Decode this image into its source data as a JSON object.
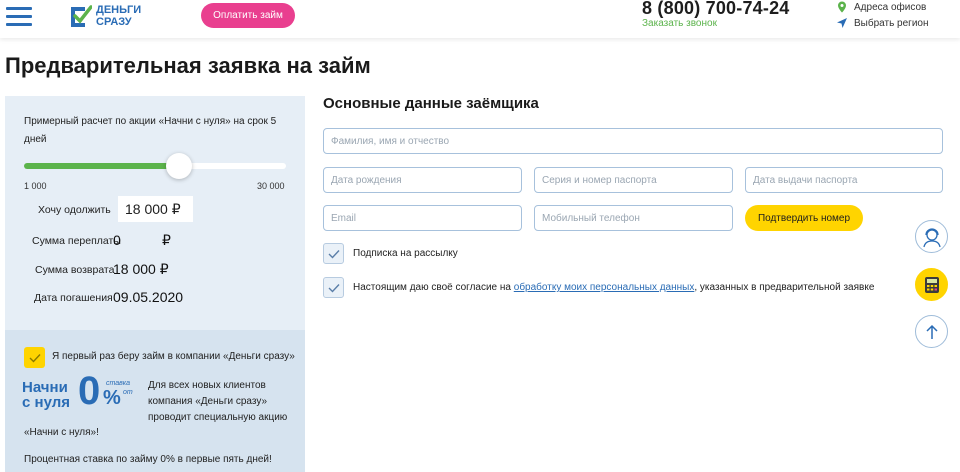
{
  "header": {
    "logo_line1": "ДЕНЬГИ",
    "logo_line2": "СРАЗУ",
    "pay_button": "Оплатить займ",
    "phone": "8 (800) 700-74-24",
    "callback": "Заказать звонок",
    "offices": "Адреса офисов",
    "region": "Выбрать регион"
  },
  "page_title": "Предварительная заявка на займ",
  "calculator": {
    "description": "Примерный расчет по акции «Начни с нуля» на срок 5 дней",
    "slider_min": "1 000",
    "slider_max": "30 000",
    "slider_value_fraction": 0.59,
    "want_label": "Хочу одолжить",
    "want_value": "18 000 ₽",
    "overpay_label": "Сумма переплаты",
    "overpay_value": "0",
    "overpay_currency": "₽",
    "return_label": "Сумма возврата",
    "return_value": "18 000 ₽",
    "due_label": "Дата погашения",
    "due_value": "09.05.2020"
  },
  "promo": {
    "checkbox_label": "Я первый раз беру займ в компании «Деньги сразу»",
    "logo_line1": "Начни",
    "logo_line2": "с нуля",
    "logo_zero": "0",
    "logo_percent": "%",
    "logo_small1": "ставка",
    "logo_small2": "от",
    "description": "Для всех новых клиентов компания «Деньги сразу» проводит специальную акцию",
    "description2": "«Начни с нуля»!",
    "description3": "Процентная ставка по займу 0% в первые пять дней!"
  },
  "form": {
    "section_title": "Основные данные заёмщика",
    "fullname_placeholder": "Фамилия, имя и отчество",
    "birthdate_placeholder": "Дата рождения",
    "passport_placeholder": "Серия и номер паспорта",
    "passport_date_placeholder": "Дата выдачи паспорта",
    "email_placeholder": "Email",
    "phone_placeholder": "Мобильный телефон",
    "confirm_button": "Подтвердить номер",
    "subscribe_label": "Подписка на рассылку",
    "consent_prefix": "Настоящим даю своё согласие на",
    "consent_link": "обработку моих персональных данных",
    "consent_suffix": ", указанных в предварительной заявке"
  },
  "colors": {
    "brand_blue": "#2a6cb5",
    "brand_green": "#5bb34b",
    "pink": "#e93f8f",
    "yellow": "#ffd400"
  },
  "icons": {
    "menu": "burger-menu-icon",
    "offices": "map-pin-icon",
    "region": "location-arrow-icon",
    "support": "operator-avatar-icon",
    "calculator": "calculator-icon",
    "scroll_top": "arrow-up-icon"
  }
}
